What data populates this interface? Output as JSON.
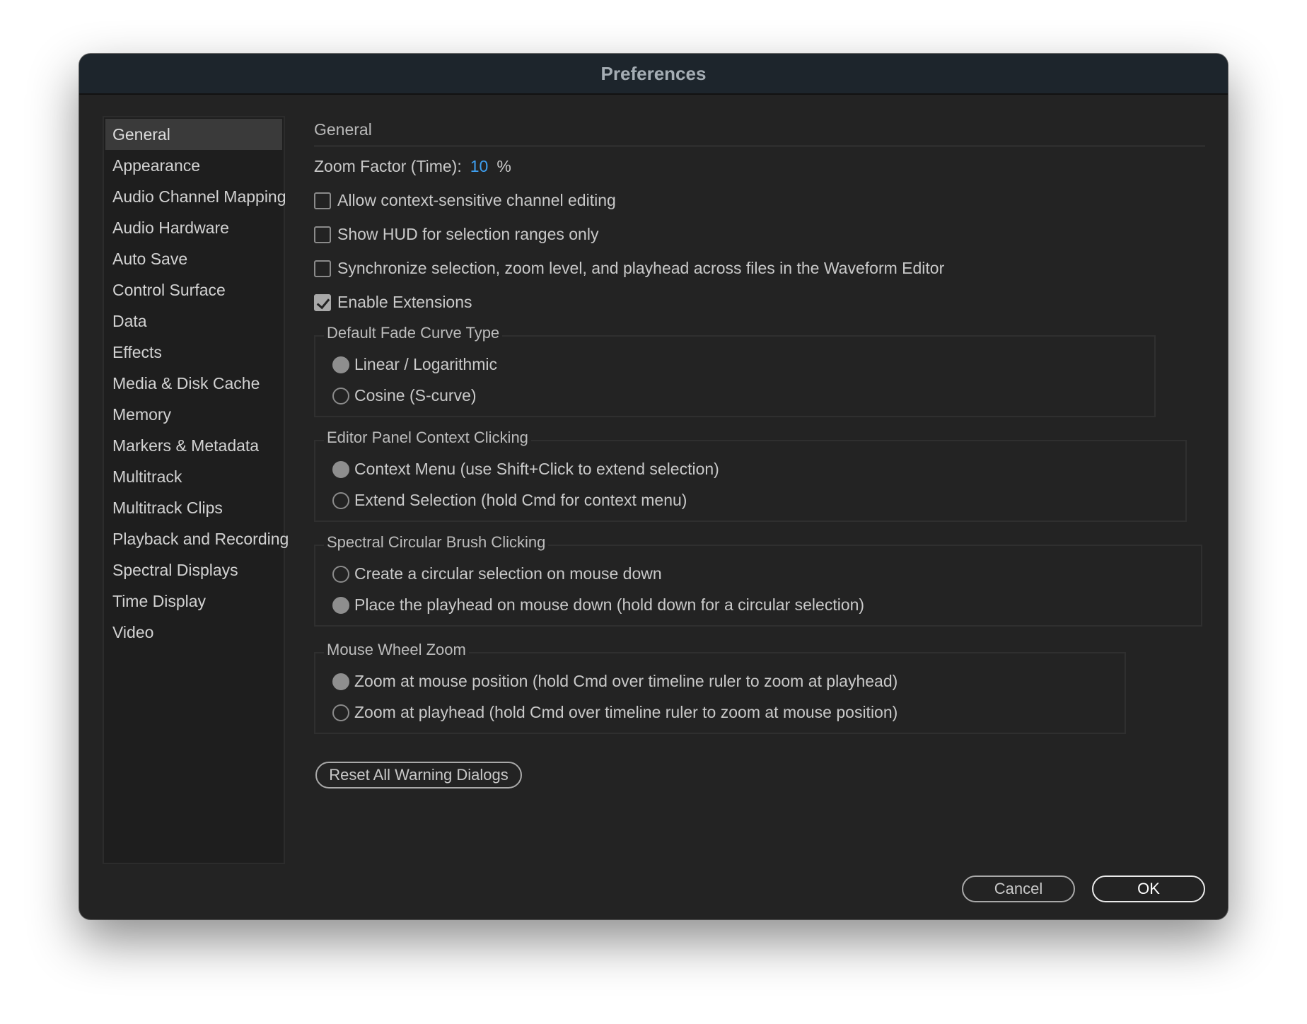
{
  "window": {
    "title": "Preferences"
  },
  "sidebar": {
    "items": [
      {
        "label": "General",
        "selected": true
      },
      {
        "label": "Appearance"
      },
      {
        "label": "Audio Channel Mapping"
      },
      {
        "label": "Audio Hardware"
      },
      {
        "label": "Auto Save"
      },
      {
        "label": "Control Surface"
      },
      {
        "label": "Data"
      },
      {
        "label": "Effects"
      },
      {
        "label": "Media & Disk Cache"
      },
      {
        "label": "Memory"
      },
      {
        "label": "Markers & Metadata"
      },
      {
        "label": "Multitrack"
      },
      {
        "label": "Multitrack Clips"
      },
      {
        "label": "Playback and Recording"
      },
      {
        "label": "Spectral Displays"
      },
      {
        "label": "Time Display"
      },
      {
        "label": "Video"
      }
    ]
  },
  "general": {
    "header": "General",
    "zoom_factor": {
      "label": "Zoom Factor (Time):",
      "value": "10",
      "unit": "%"
    },
    "checkboxes": [
      {
        "label": "Allow context-sensitive channel editing",
        "checked": false
      },
      {
        "label": "Show HUD for selection ranges only",
        "checked": false
      },
      {
        "label": "Synchronize selection, zoom level, and playhead across files in the Waveform Editor",
        "checked": false
      },
      {
        "label": "Enable Extensions",
        "checked": true
      }
    ],
    "groups": [
      {
        "title": "Default Fade Curve Type",
        "options": [
          {
            "label": "Linear / Logarithmic",
            "selected": true
          },
          {
            "label": "Cosine (S-curve)",
            "selected": false
          }
        ]
      },
      {
        "title": "Editor Panel Context Clicking",
        "options": [
          {
            "label": "Context Menu (use Shift+Click to extend selection)",
            "selected": true
          },
          {
            "label": "Extend Selection (hold Cmd for context menu)",
            "selected": false
          }
        ]
      },
      {
        "title": "Spectral Circular Brush Clicking",
        "options": [
          {
            "label": "Create a circular selection on mouse down",
            "selected": false
          },
          {
            "label": "Place the playhead on mouse down (hold down for a circular selection)",
            "selected": true
          }
        ]
      },
      {
        "title": "Mouse Wheel Zoom",
        "options": [
          {
            "label": "Zoom at mouse position (hold Cmd over timeline ruler to zoom at playhead)",
            "selected": true
          },
          {
            "label": "Zoom at playhead (hold Cmd over timeline ruler to zoom at mouse position)",
            "selected": false
          }
        ]
      }
    ],
    "reset_button": "Reset All Warning Dialogs"
  },
  "footer": {
    "cancel_label": "Cancel",
    "ok_label": "OK"
  },
  "colors": {
    "window_bg": "#232323",
    "titlebar_bg": "#1d252c",
    "accent_value": "#3e9ff0"
  }
}
